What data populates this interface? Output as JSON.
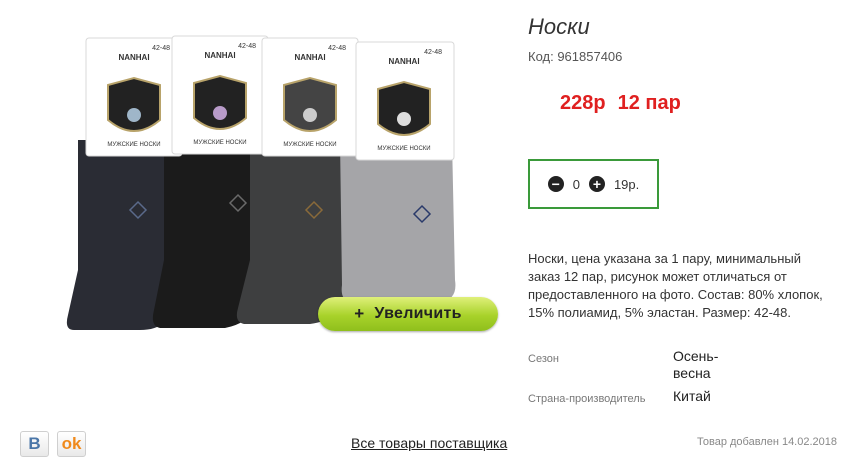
{
  "product": {
    "title": "Носки",
    "code_line": "Код: 961857406",
    "price": "228р",
    "pack": "12 пар",
    "quantity": "0",
    "unit_price": "19р.",
    "description": "Носки, цена указана за 1 пару, минимальный заказ 12 пар, рисунок может отличаться от предоставленного на фото. Состав: 80% хлопок, 15% полиамид, 5% эластан. Размер: 42-48.",
    "properties": [
      {
        "label": "Сезон",
        "value": "Осень-\nвесна"
      },
      {
        "label": "Страна-производитель",
        "value": "Китай"
      }
    ]
  },
  "image": {
    "zoom_plus": "+",
    "zoom_label": "Увеличить",
    "pack_brand": "NANHAI",
    "pack_size": "42-48",
    "pack_caption": "МУЖСКИЕ НОСКИ",
    "sock_colors": [
      "#2a2c34",
      "#1b1b1b",
      "#3e3f40",
      "#a5a5a8"
    ]
  },
  "controls": {
    "minus_icon": "minus-circle-icon",
    "plus_icon": "plus-circle-icon"
  },
  "footer": {
    "vk_label": "В",
    "ok_label": "ok",
    "supplier_link": "Все товары поставщика",
    "added": "Товар добавлен 14.02.2018"
  },
  "colors": {
    "price": "#e02020",
    "qty_border": "#3a9a3a",
    "zoom_button": "#a8d22a"
  }
}
